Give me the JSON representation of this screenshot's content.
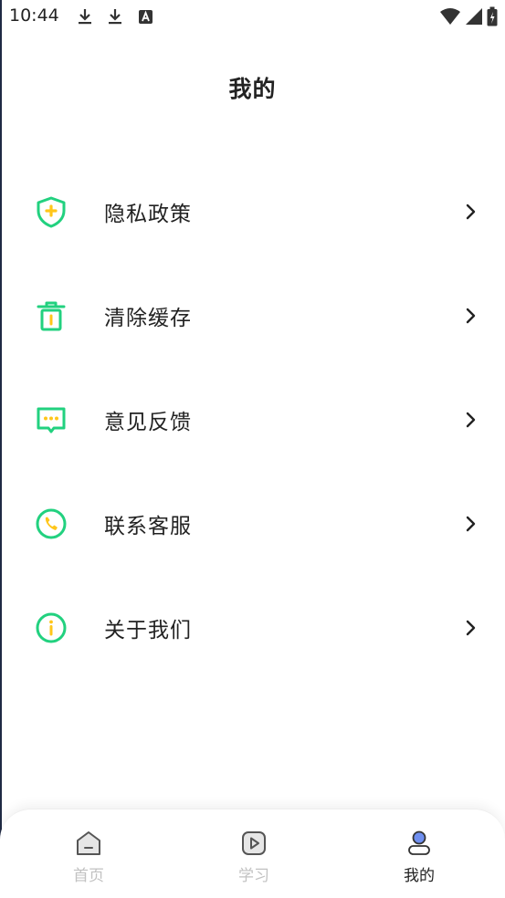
{
  "status_bar": {
    "time": "10:44",
    "icons": [
      "download-icon",
      "download-icon",
      "font-icon",
      "wifi-icon",
      "signal-icon",
      "battery-icon"
    ]
  },
  "header": {
    "title": "我的"
  },
  "menu": {
    "accent_color": "#22d17f",
    "items": [
      {
        "label": "隐私政策",
        "icon": "shield-icon"
      },
      {
        "label": "清除缓存",
        "icon": "trash-icon"
      },
      {
        "label": "意见反馈",
        "icon": "message-icon"
      },
      {
        "label": "联系客服",
        "icon": "phone-icon"
      },
      {
        "label": "关于我们",
        "icon": "info-icon"
      }
    ]
  },
  "bottom_nav": {
    "active_index": 2,
    "items": [
      {
        "label": "首页",
        "icon": "home-icon"
      },
      {
        "label": "学习",
        "icon": "play-icon"
      },
      {
        "label": "我的",
        "icon": "profile-icon"
      }
    ]
  }
}
